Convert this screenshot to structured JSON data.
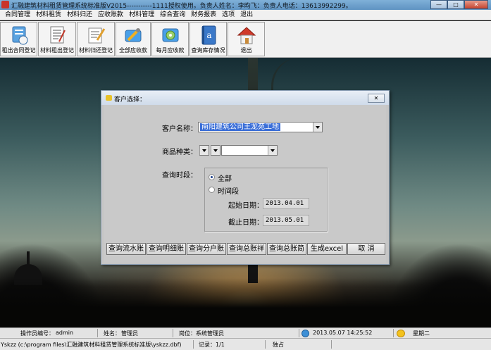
{
  "window": {
    "title": "汇融建筑材料租赁管理系统标准版V2015-----------1111授权使用。负责人姓名：李昀飞：负责人电话：13613992299。",
    "minimize": "—",
    "maximize": "□",
    "close": "✕"
  },
  "menu": [
    "合同管理",
    "材料租赁",
    "材料归还",
    "应收账款",
    "材料管理",
    "综合查询",
    "财务报表",
    "选项",
    "退出"
  ],
  "toolbar": [
    {
      "label": "租出合同登记",
      "icon": "contract-register-icon"
    },
    {
      "label": "材料租出登记",
      "icon": "rent-out-icon"
    },
    {
      "label": "材料归还登记",
      "icon": "return-icon"
    },
    {
      "label": "全部应收款",
      "icon": "receivable-all-icon"
    },
    {
      "label": "每月应收款",
      "icon": "receivable-monthly-icon"
    },
    {
      "label": "查询库存情况",
      "icon": "inventory-book-icon"
    },
    {
      "label": "退出",
      "icon": "home-exit-icon"
    }
  ],
  "dialog": {
    "title": "客户选择：",
    "close": "✕",
    "customer_label": "客户名称：",
    "customer_value": "南阳建筑公司王龙苑工地",
    "category_label": "商品种类：",
    "category_a": "",
    "category_b": "",
    "category_c": "",
    "period_label": "查询时段：",
    "radio_all": "全部",
    "radio_range": "时间段",
    "start_label": "起始日期：",
    "start_value": "2013.04.01",
    "end_label": "截止日期：",
    "end_value": "2013.05.01",
    "buttons": [
      "查询流水账",
      "查询明细账",
      "查询分户账",
      "查询总账祥",
      "查询总账简",
      "生成excel",
      "取 消"
    ]
  },
  "status": {
    "operator_label": "操作员编号：",
    "operator_value": "admin",
    "name_label": "姓名：",
    "name_value": "管理员",
    "post_label": "岗位：",
    "post_value": "系统管理员",
    "datetime": "2013.05.07  14:25:52",
    "weekday": "星期二",
    "path": "Yskzz (c:\\program files\\汇融建筑材料租赁管理系统标准版\\yskzz.dbf)",
    "record": "记录：1/1",
    "mode": "独占"
  },
  "colors": {
    "accent": "#3b6fd8",
    "dialog_bg": "#c9c9c9"
  }
}
